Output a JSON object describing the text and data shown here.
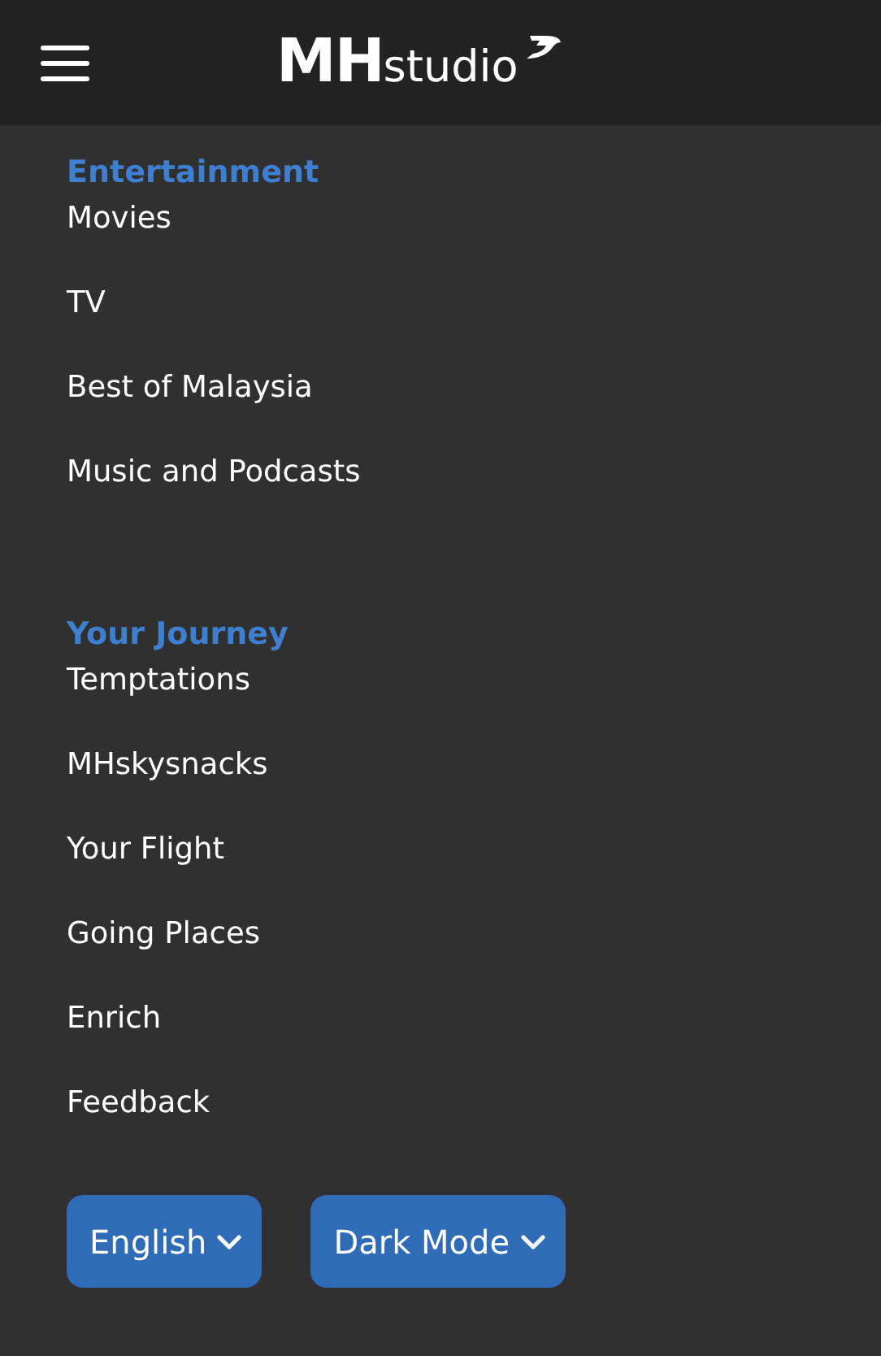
{
  "header": {
    "logo": {
      "bold": "MH",
      "light": "studio"
    }
  },
  "sections": [
    {
      "title": "Entertainment",
      "items": [
        "Movies",
        "TV",
        "Best of Malaysia",
        "Music and Podcasts"
      ]
    },
    {
      "title": "Your Journey",
      "items": [
        "Temptations",
        "MHskysnacks",
        "Your Flight",
        "Going Places",
        "Enrich",
        "Feedback"
      ]
    }
  ],
  "buttons": [
    "English",
    "Dark Mode"
  ]
}
